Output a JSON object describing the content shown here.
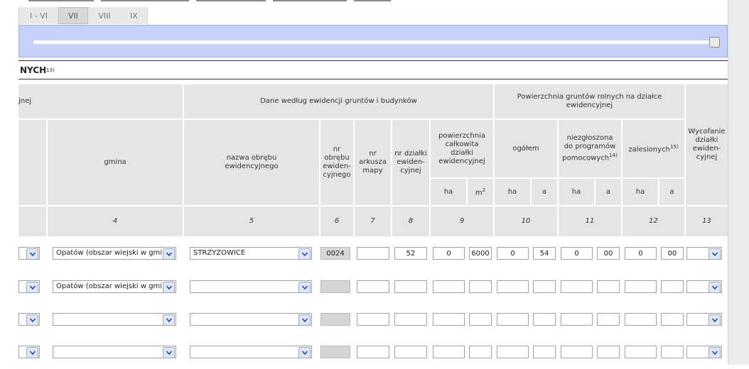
{
  "tabs": [
    {
      "label": "I - VI",
      "active": false
    },
    {
      "label": "VII",
      "active": true
    },
    {
      "label": "VIII",
      "active": false
    },
    {
      "label": "IX",
      "active": false
    }
  ],
  "section": {
    "title": "NYCH",
    "note": "13)"
  },
  "headers": {
    "col_first": "jnej",
    "group_ewidencja": "Dane według ewidencji gruntów i budynków",
    "group_powierzchnia": "Powierzchnia gruntów rolnych na działce ewidencyjnej",
    "wycofanie": "Wycofanie działki ewiden-cyjnej",
    "gmina": "gmina",
    "nazwa_obrebu": "nazwa obrębu ewidencyjnego",
    "nr_obrebu": "nr obrębu ewiden-cyjnego",
    "nr_arkusza": "nr arkusza mapy",
    "nr_dzialki": "nr działki ewiden-cyjnej",
    "pow_calkowita": "powierzchnia całkowita działki ewidencyjnej",
    "ogolem": "ogółem",
    "niezgloszona": "niezgłoszona do programów pomocowych",
    "niezgloszona_note": "14)",
    "zalesionych": "zalesionych",
    "zalesionych_note": "15)",
    "unit_ha": "ha",
    "unit_m2": "m",
    "unit_m2_sup": "2",
    "unit_a": "a"
  },
  "col_numbers": [
    "4",
    "5",
    "6",
    "7",
    "8",
    "9",
    "10",
    "11",
    "12",
    "13"
  ],
  "rows": [
    {
      "gmina": "Opatów (obszar wiejski w gmin",
      "obreb": "STRZYŻOWICE",
      "nr_obrebu": "0024",
      "nr_arkusza": "",
      "nr_dzialki": "52",
      "pow_ha": "0",
      "pow_m2": "6000",
      "og_ha": "0",
      "og_a": "54",
      "niez_ha": "0",
      "niez_a": "00",
      "zal_ha": "0",
      "zal_a": "00",
      "wycofanie": ""
    },
    {
      "gmina": "Opatów (obszar wiejski w gmin",
      "obreb": "",
      "nr_obrebu": "",
      "nr_arkusza": "",
      "nr_dzialki": "",
      "pow_ha": "",
      "pow_m2": "",
      "og_ha": "",
      "og_a": "",
      "niez_ha": "",
      "niez_a": "",
      "zal_ha": "",
      "zal_a": "",
      "wycofanie": ""
    },
    {
      "gmina": "",
      "obreb": "",
      "nr_obrebu": "",
      "nr_arkusza": "",
      "nr_dzialki": "",
      "pow_ha": "",
      "pow_m2": "",
      "og_ha": "",
      "og_a": "",
      "niez_ha": "",
      "niez_a": "",
      "zal_ha": "",
      "zal_a": "",
      "wycofanie": ""
    },
    {
      "gmina": "",
      "obreb": "",
      "nr_obrebu": "",
      "nr_arkusza": "",
      "nr_dzialki": "",
      "pow_ha": "",
      "pow_m2": "",
      "og_ha": "",
      "og_a": "",
      "niez_ha": "",
      "niez_a": "",
      "zal_ha": "",
      "zal_a": "",
      "wycofanie": ""
    }
  ],
  "icons": {
    "dropdown": "chevron-down-icon"
  },
  "colors": {
    "slider_panel": "#c5d1fb",
    "header_bg": "#e5e5e5",
    "readonly_bg": "#d6d6d6"
  }
}
